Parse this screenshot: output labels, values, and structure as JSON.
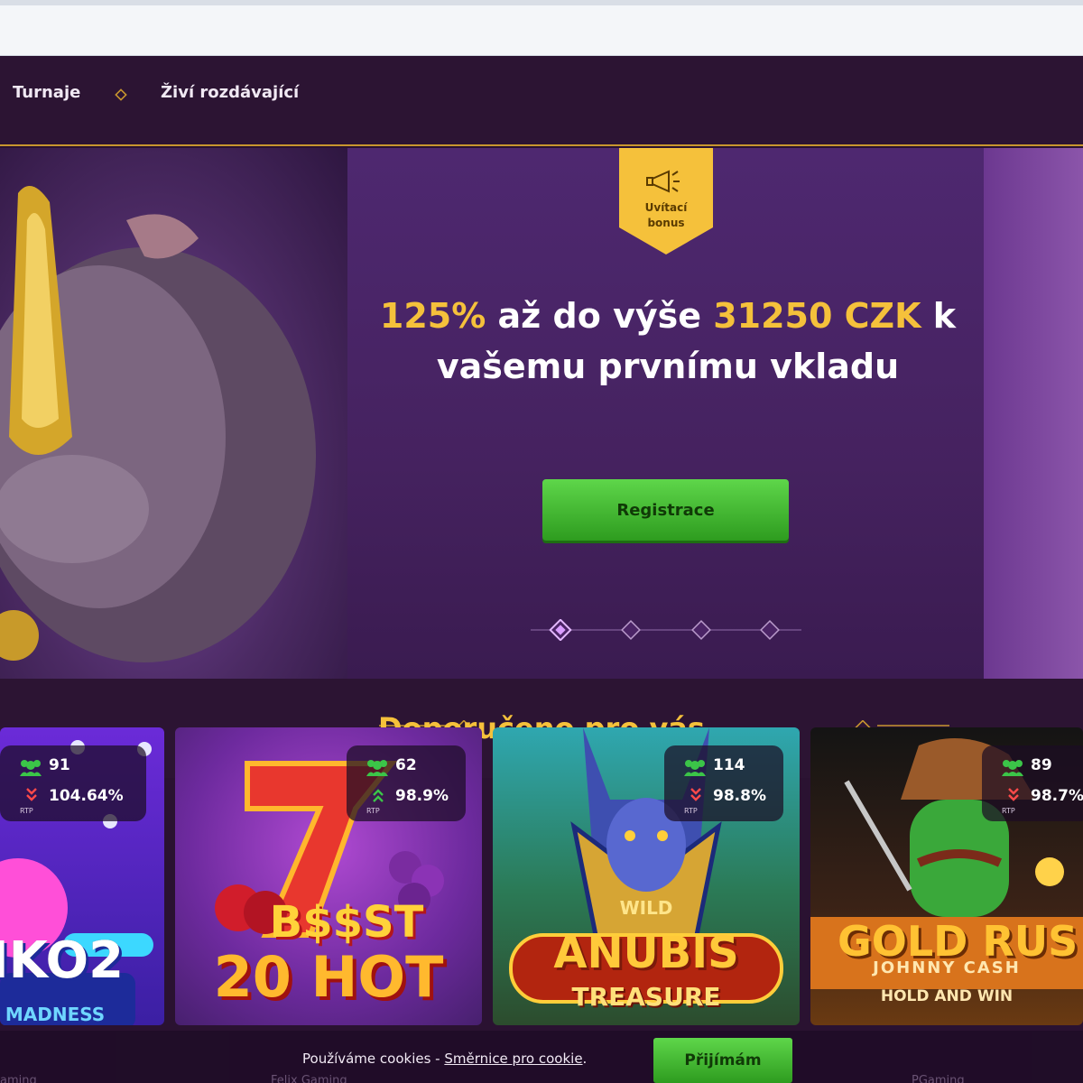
{
  "nav": {
    "items": [
      {
        "label": "Turnaje"
      },
      {
        "label": "Živí rozdávající"
      }
    ]
  },
  "hero": {
    "badge": {
      "line1": "Uvítací",
      "line2": "bonus",
      "icon": "megaphone-icon"
    },
    "headline": {
      "pct": "125%",
      "part1": " až do výše ",
      "amount": "31250 CZK",
      "part2": " k",
      "line2": "vašemu prvnímu vkladu"
    },
    "cta_label": "Registrace",
    "carousel": {
      "slides": 4,
      "active": 1
    }
  },
  "recommended": {
    "title": "Doporučeno pro vás",
    "games": [
      {
        "title": "IKO2",
        "subtitle": "ER MADNESS",
        "players": "91",
        "rtp": "104.64%",
        "rtp_label": "RTP",
        "trend": "down"
      },
      {
        "title": "B$$ST",
        "title2": "20 HOT",
        "players": "62",
        "rtp": "98.9%",
        "rtp_label": "RTP",
        "trend": "up"
      },
      {
        "title": "ANUBIS",
        "title2": "TREASURE",
        "tag": "WILD",
        "players": "114",
        "rtp": "98.8%",
        "rtp_label": "RTP",
        "trend": "down"
      },
      {
        "title": "GOLD RUS",
        "subtitle": "JOHNNY CASH",
        "subtitle2": "HOLD AND WIN",
        "players": "89",
        "rtp": "98.7%",
        "rtp_label": "RTP",
        "trend": "down"
      }
    ]
  },
  "cookie": {
    "text": "Používáme cookies - ",
    "link": "Směrnice pro cookie",
    "suffix": ".",
    "accept": "Přijímám"
  },
  "footer": {
    "left": "aming",
    "mid": "Felix Gaming",
    "right": "PGaming"
  },
  "colors": {
    "accent_gold": "#f5c13b",
    "cta_green": "#3cb22b",
    "bg_purple": "#2a1231"
  }
}
